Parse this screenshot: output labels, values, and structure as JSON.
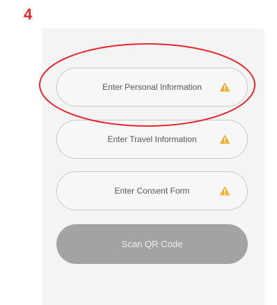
{
  "step": {
    "number": "4"
  },
  "form": {
    "items": [
      {
        "label": "Enter Personal Information",
        "status_icon": "warning-icon"
      },
      {
        "label": "Enter Travel Information",
        "status_icon": "warning-icon"
      },
      {
        "label": "Enter Consent Form",
        "status_icon": "warning-icon"
      }
    ],
    "scan_button_label": "Scan QR Code"
  },
  "colors": {
    "annotation": "#e8262b",
    "warning": "#f0ad3c",
    "disabled_button": "#a3a3a3",
    "panel": "#f4f4f4"
  }
}
